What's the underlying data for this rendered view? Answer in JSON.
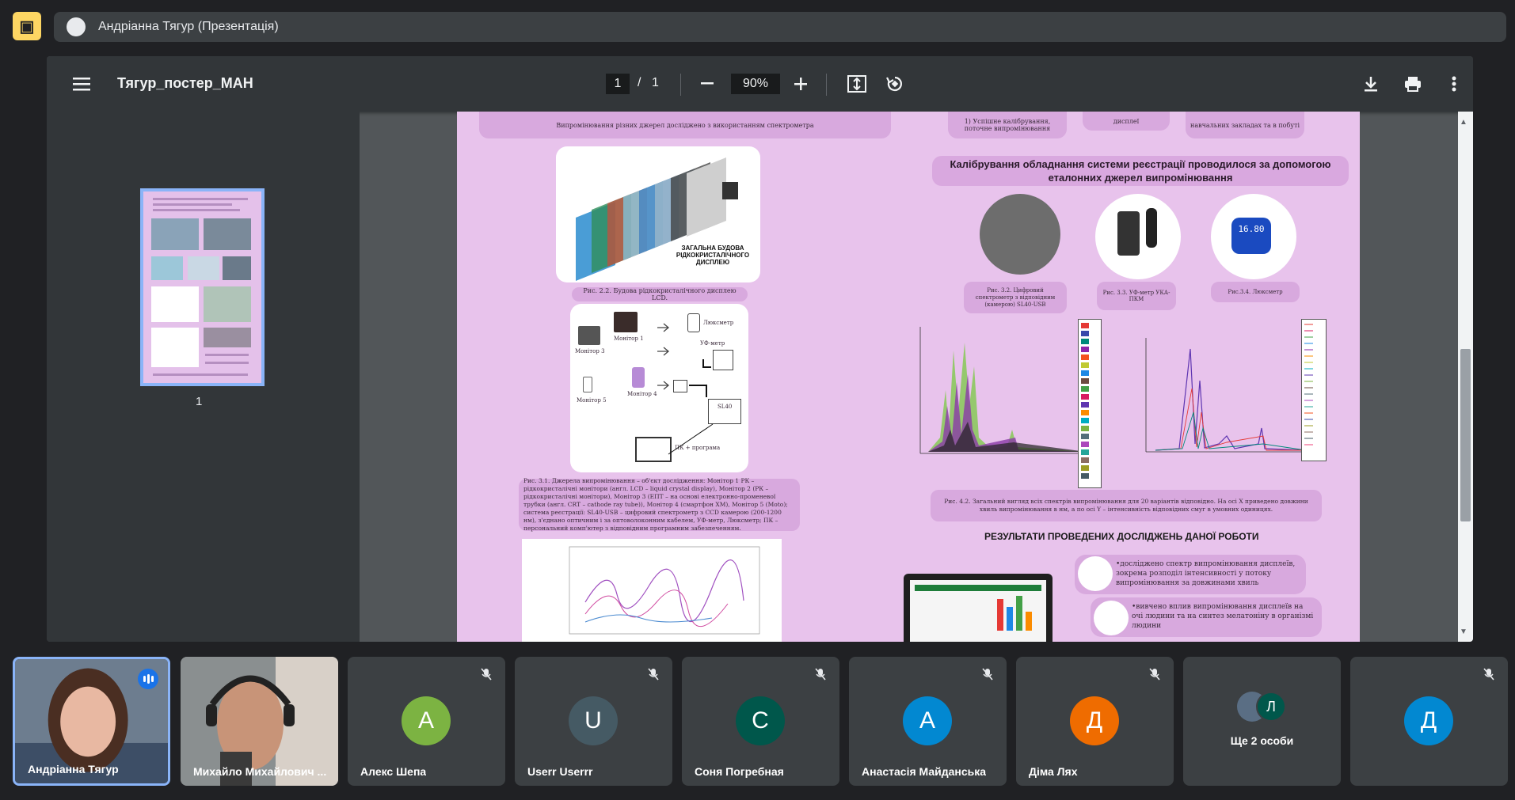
{
  "meeting": {
    "presenter_label": "Андріанна Тягур (Презентація)"
  },
  "viewer": {
    "doc_title": "Тягур_постер_МАН",
    "current_page": "1",
    "page_separator": "/",
    "total_pages": "1",
    "zoom": "90%",
    "thumbnail_label": "1"
  },
  "poster": {
    "calibration_title": "Калібрування обладнання системи реєстрації проводилося за допомогою еталонних джерел випромінювання",
    "results_title": "РЕЗУЛЬТАТИ ПРОВЕДЕНИХ ДОСЛІДЖЕНЬ ДАНОЇ РОБОТИ",
    "display_label": "ЗАГАЛЬНА БУДОВА РІДКОКРИСТАЛІЧНОГО ДИСПЛЕЮ",
    "fig22": "Рис. 2.2. Будова рідкокристалічного дисплею LCD.",
    "fig32": "Рис. 3.2. Цифровий спектрометр з відповідним (камерою) SL40-USB",
    "fig33": "Рис. 3.3. УФ-метр УКА-ПКМ",
    "fig34": "Рис.3.4. Люксметр",
    "fig31": "Рис. 3.1. Джерела випромінювання – об'єкт дослідження: Монітор 1 РК – рідкокристалічні монітори (англ. LCD – liquid crystal display), Монітор 2 (РК – рідкокристалічні монітори), Монітор 3 (ЕПТ – на основі електронно-променевої трубки (англ. CRT – cathode ray tube)), Монітор 4 (смартфон XM), Монітор 5 (Moto); система реєстрації: SL40-USB – цифровий спектрометр з CCD камерою (200-1200 нм), з'єднано оптичним і за оптоволоконним кабелем, УФ-метр, Люксметр; ПК – персональний комп'ютер з відповідним програмним забезпеченням.",
    "fig42": "Рис. 4.2. Загальний вигляд всіх спектрів випромінювання для 20 варіантів відповідно. На осі X приведено довжини хвиль випромінювання в нм, а по осі Y – інтенсивність відповідних смуг в умовних одиницях.",
    "bullet1": "•досліджено спектр випромінювання дисплеїв, зокрема розподіл інтенсивності у потоку випромінювання за довжинами хвиль",
    "bullet2": "•вивчено вплив випромінювання дисплеїв на очі людини та на синтез мелатоніну в організмі людини",
    "top_text_left": "Випромінювання різних джерел досліджено з використанням спектрометра",
    "top_text_right1": "1) Успішне калібрування, поточне випромінювання",
    "top_text_right2": "дисплеї",
    "top_text_right3": "навчальних закладах та в побуті",
    "monitor1": "Монітор 1",
    "monitor2": "Монітор 2",
    "monitor3": "Монітор 3",
    "monitor4": "Монітор 4",
    "monitor5": "Монітор 5",
    "luxmeter": "Люксметр",
    "uvmeter": "УФ-метр",
    "sl40": "SL40",
    "pc": "ПК + програма",
    "lux_display": "16.80"
  },
  "participants": [
    {
      "name": "Андріанна Тягур",
      "type": "video",
      "speaking": true
    },
    {
      "name": "Михайло Михайлович ...",
      "type": "video",
      "speaking": false
    },
    {
      "name": "Алекс Шепа",
      "initial": "А",
      "color": "#7cb342",
      "muted": true
    },
    {
      "name": "Userr Userrr",
      "initial": "U",
      "color": "#455a64",
      "muted": true
    },
    {
      "name": "Соня Погребная",
      "initial": "С",
      "color": "#00574b",
      "muted": true
    },
    {
      "name": "Анастасія Майданська",
      "initial": "А",
      "color": "#0288d1",
      "muted": true
    },
    {
      "name": "Діма Лях",
      "initial": "Д",
      "color": "#ef6c00",
      "muted": true
    },
    {
      "name": "Ще 2 особи",
      "initial": "Л",
      "color": "#00574b",
      "muted": false
    },
    {
      "name": "",
      "initial": "Д",
      "color": "#0288d1",
      "muted": true
    }
  ],
  "icons": {
    "present": "presentation-off-icon",
    "menu": "hamburger-menu-icon",
    "zoom_out": "minus-icon",
    "zoom_in": "plus-icon",
    "fit": "fit-page-icon",
    "rotate": "rotate-icon",
    "download": "download-icon",
    "print": "print-icon",
    "more": "more-vert-icon",
    "mute": "mic-off-icon"
  }
}
